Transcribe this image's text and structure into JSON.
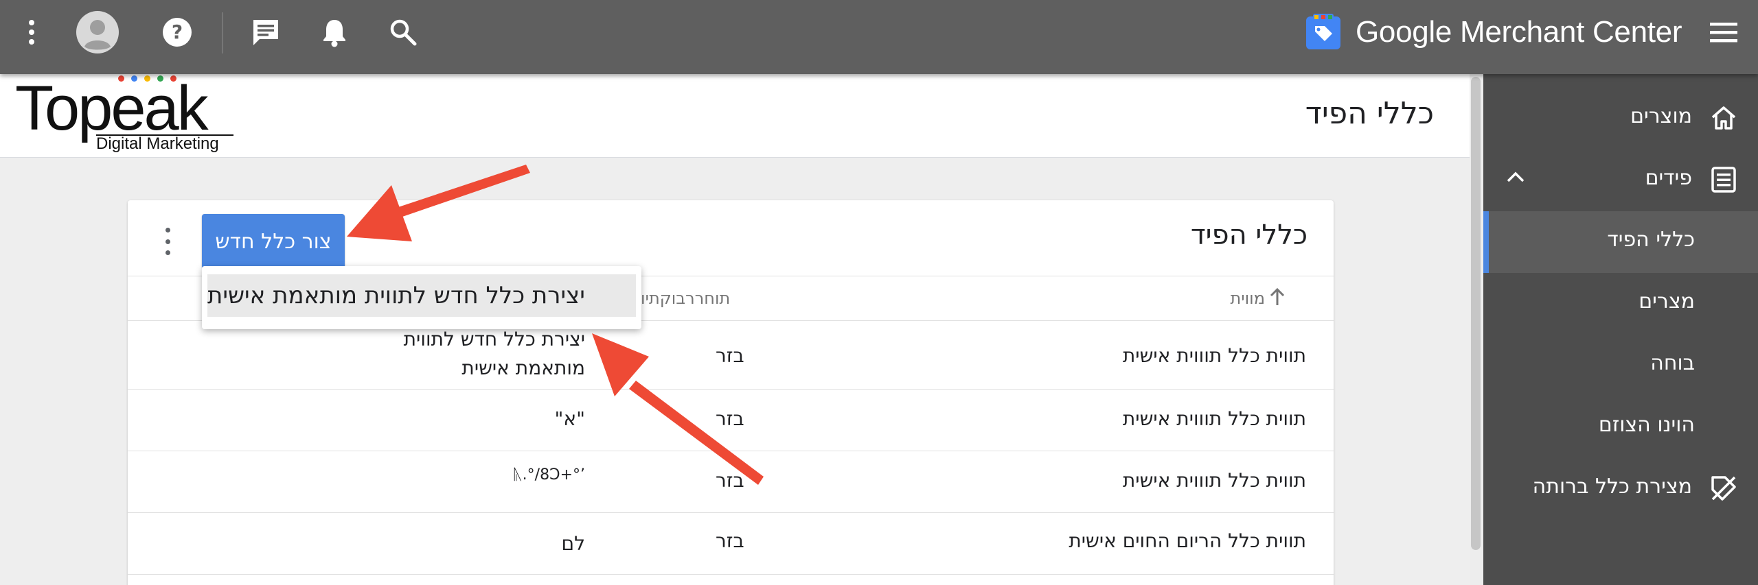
{
  "topbar": {
    "brand": "Google Merchant Center",
    "brand_color": "#4285f4",
    "icons": [
      "more-vert-icon",
      "account-avatar-icon",
      "help-icon",
      "chat-icon",
      "notifications-bell-icon",
      "search-icon",
      "hamburger-menu-icon"
    ]
  },
  "header": {
    "logo_main": "Topeak",
    "logo_sub": "Digital Marketing",
    "logo_dot_colors": [
      "#ea4335",
      "#4285f4",
      "#fbbc05",
      "#34a853",
      "#ea4335"
    ],
    "page_title": "כללי הפיד"
  },
  "card": {
    "title": "כללי הפיד",
    "create_button": "צור כלל חדש",
    "columns": {
      "name": "מווית",
      "status": "תוחררבוקתיויה"
    },
    "rows": [
      {
        "name": "תווית כלל תוווית אישית",
        "status": "בזר",
        "desc_line1": "יצירת כלל חדש לתווית",
        "desc_line2": "מותאמת אישית"
      },
      {
        "name": "תווית כלל תוווית אישית",
        "status": "בזר",
        "desc_line1": "\"א\"",
        "desc_line2": ""
      },
      {
        "name": "תווית כלל תוווית אישית",
        "status": "בזר",
        "desc_line1": "’°+ᚣ.°/8Ɔ",
        "desc_line2": ""
      },
      {
        "name": "תווית כלל הריום החוים אישית",
        "status": "בזר",
        "desc_line1": "לם",
        "desc_line2": ""
      }
    ]
  },
  "menu": {
    "item": "יצירת כלל חדש לתווית מותאמת אישית"
  },
  "sidebar": {
    "items": [
      {
        "label": "מוצרים",
        "icon": "home-icon"
      },
      {
        "label": "פידים",
        "icon": "feed-list-icon"
      },
      {
        "label": "כללי הפיד",
        "icon": ""
      },
      {
        "label": "מצרים",
        "icon": ""
      },
      {
        "label": "בוחה",
        "icon": ""
      },
      {
        "label": "הוינו הצוזם",
        "icon": ""
      },
      {
        "label": "מצירת כלל ברותה",
        "icon": "tag-off-icon"
      }
    ],
    "active_index": 2,
    "accent_color": "#4a86e0"
  },
  "annotation_color": "#ee4a35"
}
